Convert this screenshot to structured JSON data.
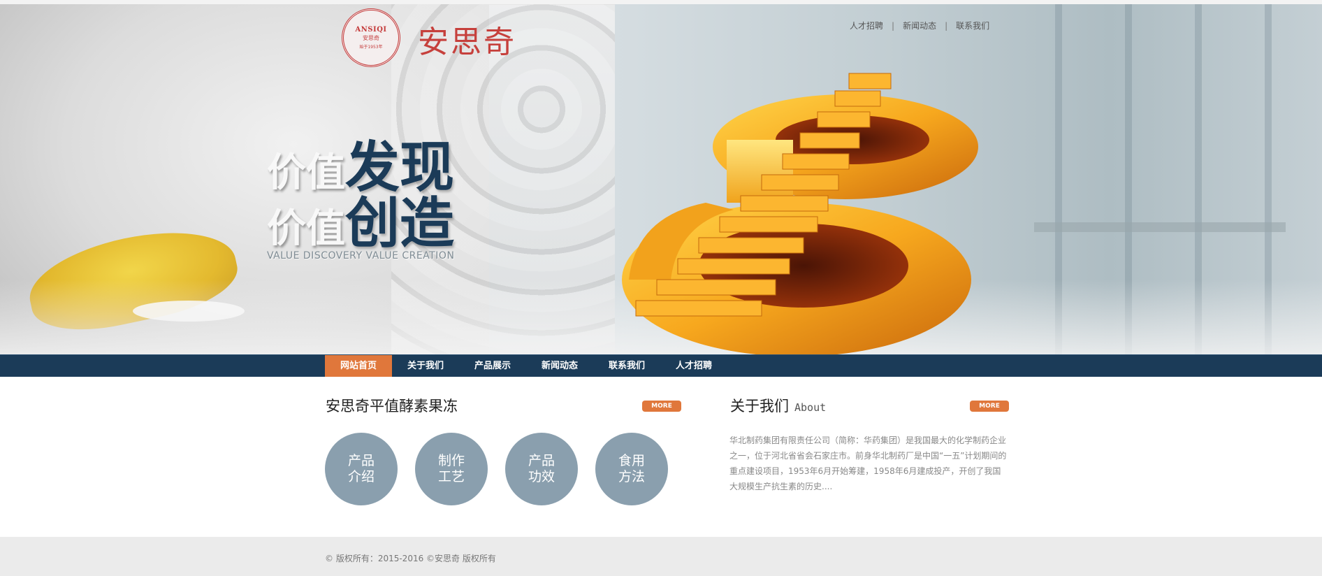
{
  "brand": {
    "seal_en": "ANSIQI",
    "seal_cn": "安思奇",
    "seal_since": "始于1953年",
    "name": "安思奇"
  },
  "top_links": [
    "人才招聘",
    "新闻动态",
    "联系我们"
  ],
  "top_link_separator": "|",
  "slogan": {
    "line1_light": "价值",
    "line1_dark": "发现",
    "line2_light": "价值",
    "line2_dark": "创造",
    "subtitle": "VALUE DISCOVERY VALUE CREATION"
  },
  "nav": {
    "items": [
      "网站首页",
      "关于我们",
      "产品展示",
      "新闻动态",
      "联系我们",
      "人才招聘"
    ],
    "active_index": 0
  },
  "products": {
    "title": "安思奇平值酵素果冻",
    "more_label": "MORE",
    "circles": [
      {
        "line1": "产品",
        "line2": "介绍"
      },
      {
        "line1": "制作",
        "line2": "工艺"
      },
      {
        "line1": "产品",
        "line2": "功效"
      },
      {
        "line1": "食用",
        "line2": "方法"
      }
    ]
  },
  "about": {
    "title": "关于我们",
    "title_en": "About",
    "more_label": "MORE",
    "text": "华北制药集团有限责任公司（简称：华药集团）是我国最大的化学制药企业之一，位于河北省省会石家庄市。前身华北制药厂是中国“一五”计划期间的重点建设项目，1953年6月开始筹建，1958年6月建成投产，开创了我国大规模生产抗生素的历史...."
  },
  "footer": {
    "copyright": "© 版权所有：2015-2016 ©安思奇 版权所有"
  },
  "colors": {
    "nav_bg": "#1b3b58",
    "accent_orange": "#e0773b",
    "circle_gray": "#8a9fae",
    "brand_red": "#c6403c",
    "footer_bg": "#ebebeb"
  }
}
